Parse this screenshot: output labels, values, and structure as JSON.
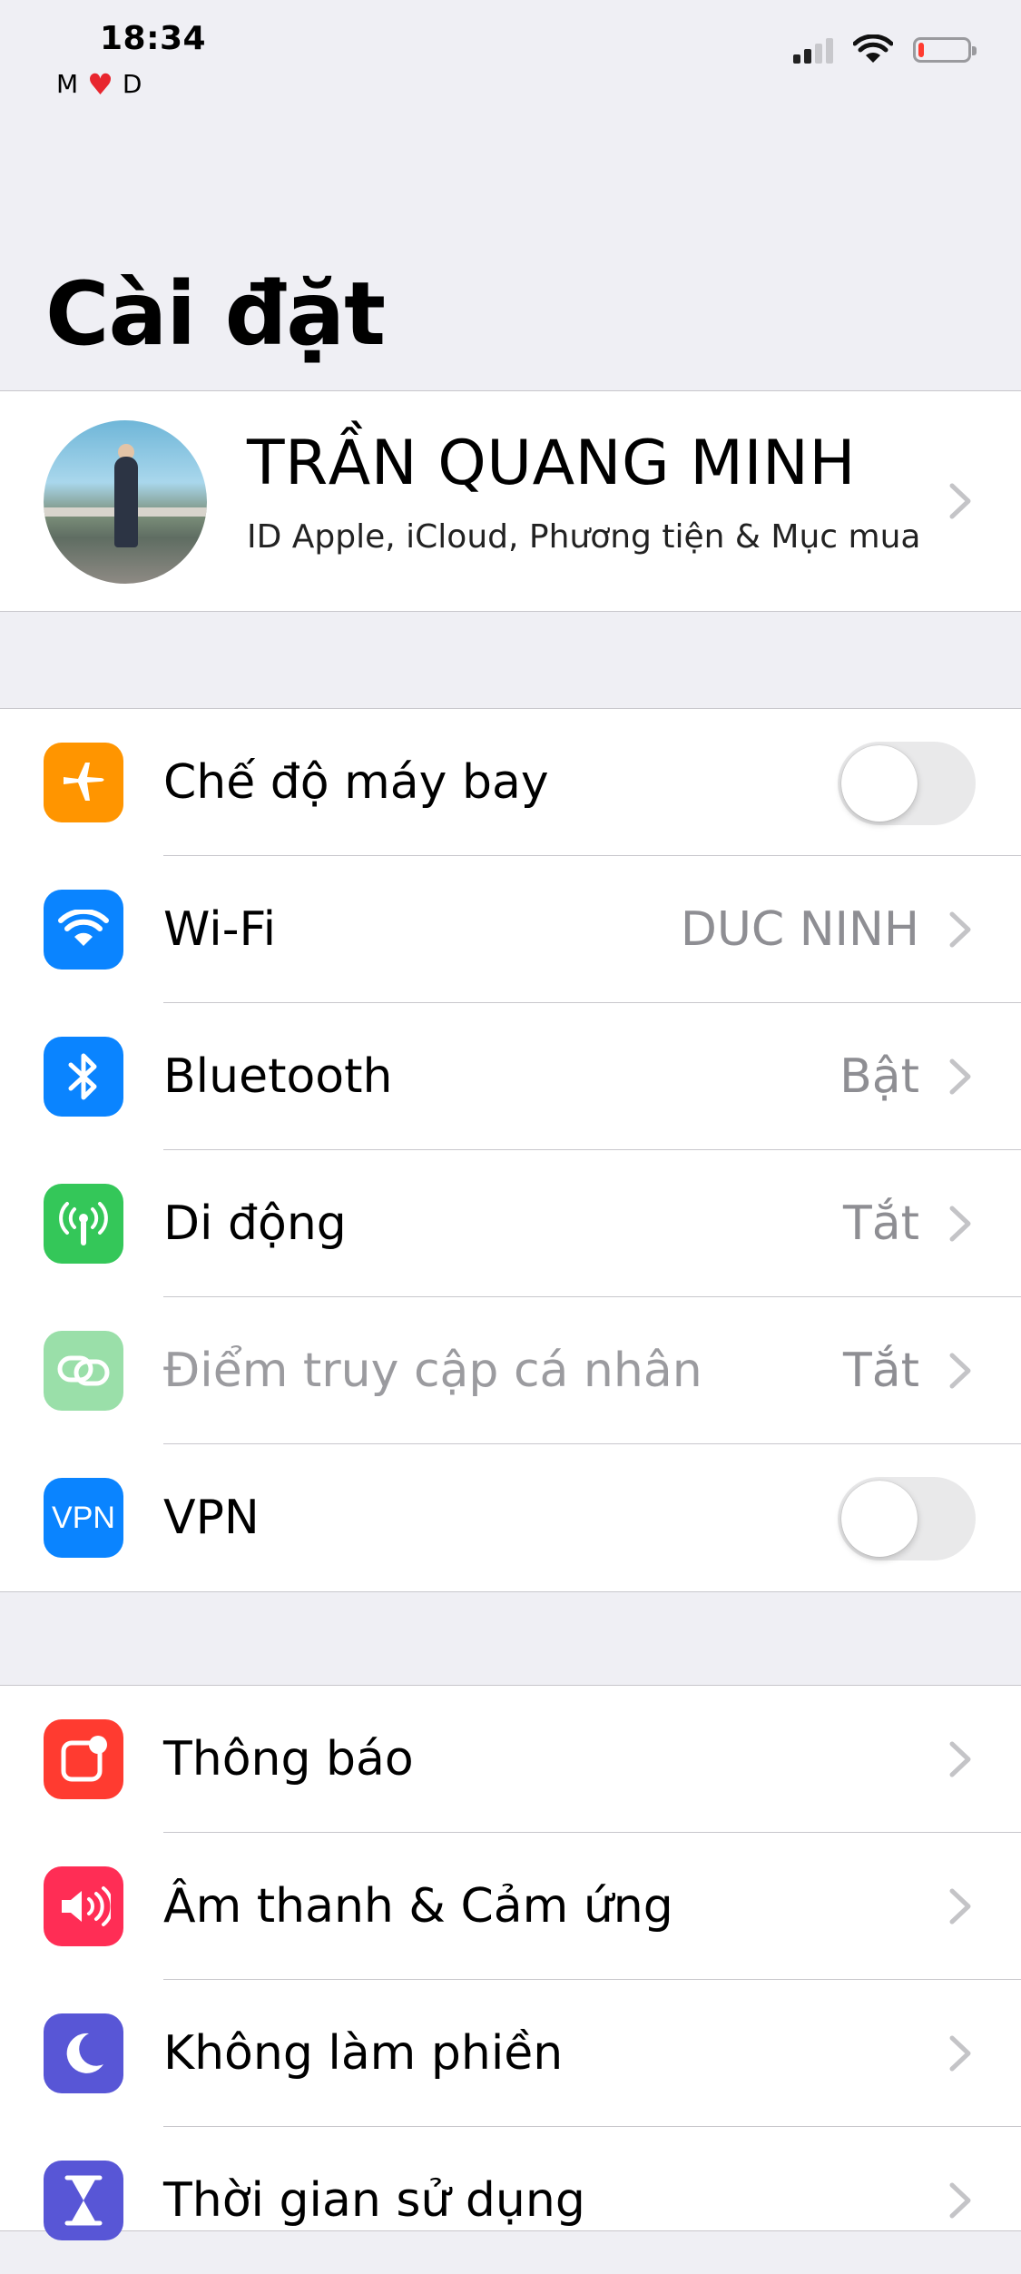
{
  "status_bar": {
    "time": "18:34",
    "carrier_left": "M",
    "carrier_right": "D",
    "battery_level": 0.1
  },
  "title": "Cài đặt",
  "profile": {
    "name": "TRẦN QUANG MINH",
    "subtitle": "ID Apple, iCloud, Phương tiện & Mục mua"
  },
  "network": [
    {
      "label": "Chế độ máy bay",
      "icon": "airplane-icon",
      "color": "#ff9500",
      "toggle": false
    },
    {
      "label": "Wi-Fi",
      "value": "DUC NINH",
      "icon": "wifi-icon",
      "color": "#0a84ff"
    },
    {
      "label": "Bluetooth",
      "value": "Bật",
      "icon": "bluetooth-icon",
      "color": "#0a84ff"
    },
    {
      "label": "Di động",
      "value": "Tắt",
      "icon": "antenna-icon",
      "color": "#34c759"
    },
    {
      "label": "Điểm truy cập cá nhân",
      "value": "Tắt",
      "icon": "hotspot-icon",
      "color": "#9adfa9",
      "disabled": true
    },
    {
      "label": "VPN",
      "icon": "vpn-icon",
      "icon_text": "VPN",
      "color": "#0a84ff",
      "toggle": false
    }
  ],
  "general": [
    {
      "label": "Thông báo",
      "icon": "notifications-icon",
      "color": "#ff3b30"
    },
    {
      "label": "Âm thanh & Cảm ứng",
      "icon": "speaker-icon",
      "color": "#ff2d55"
    },
    {
      "label": "Không làm phiền",
      "icon": "moon-icon",
      "color": "#5856d6"
    },
    {
      "label": "Thời gian sử dụng",
      "icon": "hourglass-icon",
      "color": "#5856d6"
    }
  ]
}
